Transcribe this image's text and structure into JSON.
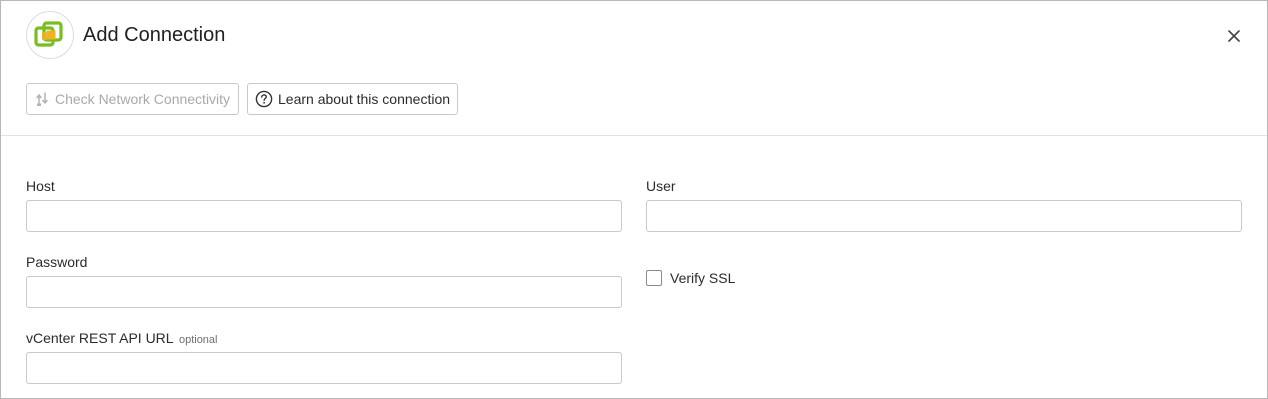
{
  "dialog": {
    "title": "Add Connection",
    "logo_icon": "vmware-vcenter-logo-icon",
    "close_icon": "close-icon"
  },
  "toolbar": {
    "check_network_label": "Check Network Connectivity",
    "check_network_icon": "network-check-icon",
    "check_network_enabled": false,
    "learn_label": "Learn about this connection",
    "learn_icon": "question-circle-icon"
  },
  "form": {
    "host": {
      "label": "Host",
      "value": ""
    },
    "user": {
      "label": "User",
      "value": ""
    },
    "password": {
      "label": "Password",
      "value": ""
    },
    "verify_ssl": {
      "label": "Verify SSL",
      "checked": false
    },
    "vcenter_url": {
      "label": "vCenter REST API URL",
      "optional_label": "optional",
      "value": ""
    }
  },
  "colors": {
    "logo_green": "#78be20",
    "logo_yellow": "#f0b323",
    "disabled_text": "#a9a9a9",
    "border": "#c9c9c9"
  }
}
